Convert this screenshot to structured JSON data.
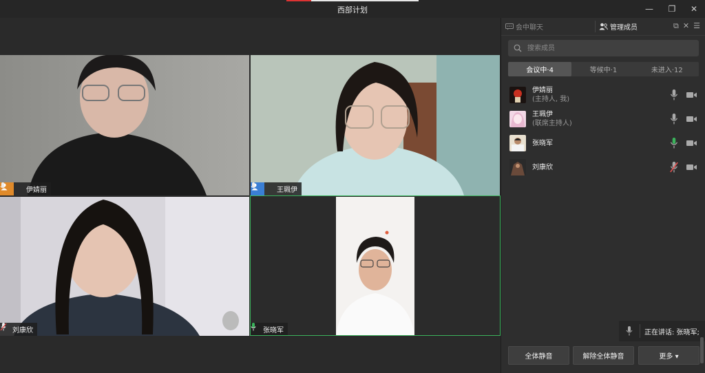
{
  "window": {
    "title": "西部计划",
    "controls": [
      "minimize-icon",
      "restore-icon",
      "close-icon"
    ]
  },
  "videos": [
    {
      "name": "伊婧丽",
      "role_icon": "host-person-icon",
      "mic": "mic-on"
    },
    {
      "name": "王珮伊",
      "role_icon": "cohost-person-icon",
      "mic": "mic-on"
    },
    {
      "name": "刘康欣",
      "role_icon": "",
      "mic": "mic-muted"
    },
    {
      "name": "张晓军",
      "role_icon": "",
      "mic": "mic-speaking"
    }
  ],
  "panel": {
    "tabs": [
      {
        "label": "会中聊天",
        "icon": "chat-icon",
        "active": false
      },
      {
        "label": "管理成员",
        "icon": "members-icon",
        "active": true
      }
    ],
    "header_icons": [
      "popout-icon",
      "close-icon",
      "menu-icon"
    ],
    "search": {
      "placeholder": "搜索成员",
      "value": ""
    },
    "segments": [
      {
        "label": "会议中·4",
        "active": true
      },
      {
        "label": "等候中·1",
        "active": false
      },
      {
        "label": "未进入·12",
        "active": false
      }
    ],
    "members": [
      {
        "name": "伊婧丽",
        "role": "(主持人, 我)",
        "mic": "on",
        "video": "on"
      },
      {
        "name": "王珮伊",
        "role": "(联席主持人)",
        "mic": "on",
        "video": "on"
      },
      {
        "name": "张晓军",
        "role": "",
        "mic": "speaking",
        "video": "on"
      },
      {
        "name": "刘康欣",
        "role": "",
        "mic": "muted",
        "video": "on"
      }
    ],
    "speaking_label": "正在讲话: 张晓军;",
    "buttons": {
      "mute_all": "全体静音",
      "unmute_all": "解除全体静音",
      "more": "更多 ▾"
    }
  },
  "colors": {
    "accent_green": "#3bb35c",
    "muted_red": "#e05050",
    "host_badge": "#e08a2a",
    "cohost_badge": "#3a7fd5"
  }
}
